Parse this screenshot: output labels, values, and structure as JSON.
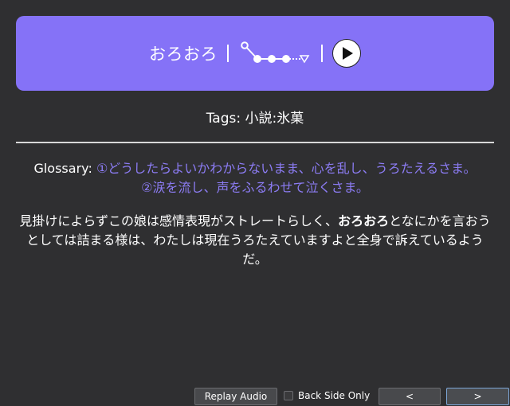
{
  "card": {
    "word": "おろおろ",
    "tags_label": "Tags:",
    "tags_value": "小説:氷菓",
    "glossary_label": "Glossary:",
    "glossary_line1": "①どうしたらよいかわからないまま、心を乱し、うろたえるさま。",
    "glossary_line2": "②涙を流し、声をふるわせて泣くさま。",
    "sentence_before": "見掛けによらずこの娘は感情表現がストレートらしく、",
    "sentence_bold": "おろおろ",
    "sentence_after": "となにかを言おうとしては詰まる様は、わたしは現在うろたえていますよと全身で訴えているようだ。"
  },
  "banner": {
    "color": "#8572f7",
    "pitch_icon": "pitch-accent-diagram-icon",
    "play_icon": "play-icon"
  },
  "controls": {
    "replay_label": "Replay Audio",
    "back_side_label": "Back Side Only",
    "back_side_checked": false,
    "prev_label": "<",
    "next_label": ">"
  }
}
